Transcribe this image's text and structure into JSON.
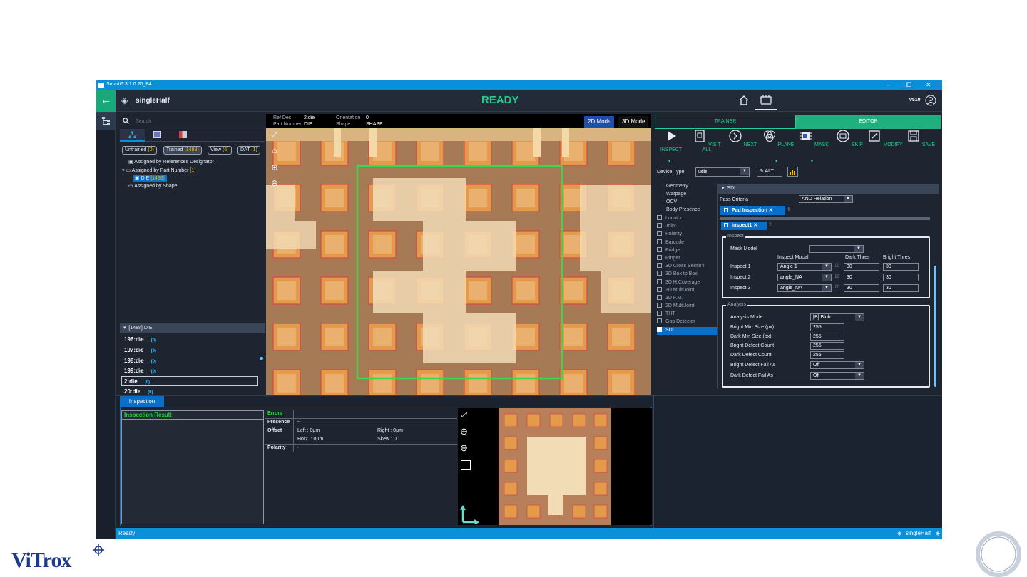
{
  "window": {
    "title": "SmartG 3.1.0.20_B4",
    "min": "–",
    "max": "⧠",
    "close": "✕"
  },
  "header": {
    "project": "singleHalf",
    "status": "READY",
    "version": "v510"
  },
  "search": {
    "placeholder": "Search"
  },
  "filters": [
    {
      "label": "Untrained",
      "count": "(0)"
    },
    {
      "label": "Trained",
      "count": "(1488)"
    },
    {
      "label": "View",
      "count": "(6)"
    },
    {
      "label": "DAT",
      "count": "(1)"
    }
  ],
  "tree": {
    "ref": "Assigned by References Designator",
    "part": "Assigned by Part Number",
    "part_count": "[1]",
    "die": "DIE",
    "die_count": "[1488]",
    "shape": "Assigned by Shape"
  },
  "list": {
    "header": "[1488] DIE",
    "rows": [
      {
        "name": "196:die",
        "z": "(0)"
      },
      {
        "name": "197:die",
        "z": "(0)"
      },
      {
        "name": "198:die",
        "z": "(0)"
      },
      {
        "name": "199:die",
        "z": "(0)"
      },
      {
        "name": "2:die",
        "z": "(0)"
      },
      {
        "name": "20:die",
        "z": "(0)"
      }
    ]
  },
  "info": {
    "refdes_label": "Ref Des",
    "refdes": "2:die",
    "pn_label": "Part Number",
    "pn": "DIE",
    "orient_label": "Orientation",
    "orient": "0",
    "shape_label": "Shape",
    "shape": "SHAPE",
    "mode2d": "2D Mode",
    "mode3d": "3D Mode"
  },
  "rtabs": {
    "trainer": "TRAINER",
    "editor": "EDITOR"
  },
  "toolbar": [
    {
      "label": "INSPECT",
      "icon": "play-icon"
    },
    {
      "label": "VISIT ALL",
      "icon": "visit-all-icon"
    },
    {
      "label": "NEXT",
      "icon": "next-icon"
    },
    {
      "label": "PLANE",
      "icon": "plane-icon"
    },
    {
      "label": "MASK",
      "icon": "mask-icon"
    },
    {
      "label": "SKIP",
      "icon": "skip-icon"
    },
    {
      "label": "MODIFY",
      "icon": "modify-icon"
    },
    {
      "label": "SAVE",
      "icon": "save-icon"
    }
  ],
  "device": {
    "label": "Device Type",
    "value": "udie",
    "alt": "ALT"
  },
  "menu": {
    "plain": [
      "Geometry",
      "Warpage",
      "OCV",
      "Body Presence"
    ],
    "checks": [
      "Locator",
      "Joint",
      "Polarity",
      "Barcode",
      "Bridge",
      "Ringer",
      "3D Cross Section",
      "3D Box to Box",
      "3D H.Coverage",
      "3D MultiJoint",
      "3D F.M.",
      "2D MultiJoint",
      "THT",
      "Gap Detector"
    ],
    "selected": "SDI"
  },
  "sdi": {
    "title": "SDI",
    "pass_label": "Pass Criteria",
    "pass_value": "AND Relation",
    "tab1": "Pad Inspection",
    "tab2": "Inspect1",
    "inspect_legend": "Inspect",
    "mask_label": "Mask Model",
    "col_modal": "Inspect Modal",
    "col_dark": "Dark Thres",
    "col_bright": "Bright Thres",
    "rows": [
      {
        "label": "Inspect 1",
        "modal": "Angle 1",
        "dark": "30",
        "bright": "30"
      },
      {
        "label": "Inspect 2",
        "modal": "angle_NA",
        "dark": "30",
        "bright": "30"
      },
      {
        "label": "Inspect 3",
        "modal": "angle_NA",
        "dark": "30",
        "bright": "30"
      }
    ],
    "analysis_legend": "Analysis",
    "analysis": [
      {
        "label": "Analysis Mode",
        "value": "[B] Blob",
        "kind": "dd"
      },
      {
        "label": "Bright Min Size (px)",
        "value": "255",
        "kind": "field"
      },
      {
        "label": "Dark Min Size (px)",
        "value": "255",
        "kind": "field"
      },
      {
        "label": "Bright Defect Count",
        "value": "255",
        "kind": "field"
      },
      {
        "label": "Dark Defect Count",
        "value": "255",
        "kind": "field"
      },
      {
        "label": "Bright Defect Fail As",
        "value": "Off",
        "kind": "dd"
      },
      {
        "label": "Dark Defect Fail As",
        "value": "Off",
        "kind": "dd"
      }
    ]
  },
  "bottom": {
    "tab": "Inspection",
    "result_title": "Inspection Result",
    "errors": "Errors",
    "presence": "Presence",
    "presence_val": "--",
    "offset": "Offset",
    "left": "Left : 0μm",
    "right": "Right : 0μm",
    "horz": "Horz. : 0μm",
    "skew": "Skew : 0",
    "polarity": "Polarity",
    "polarity_val": "--"
  },
  "statusbar": {
    "left": "Ready",
    "right": "singleHalf"
  },
  "brand": {
    "logo": "ViTrox"
  },
  "colors": {
    "accent": "#1fcf8a",
    "blue": "#0a8fd8",
    "roi": "#3cd84a"
  }
}
